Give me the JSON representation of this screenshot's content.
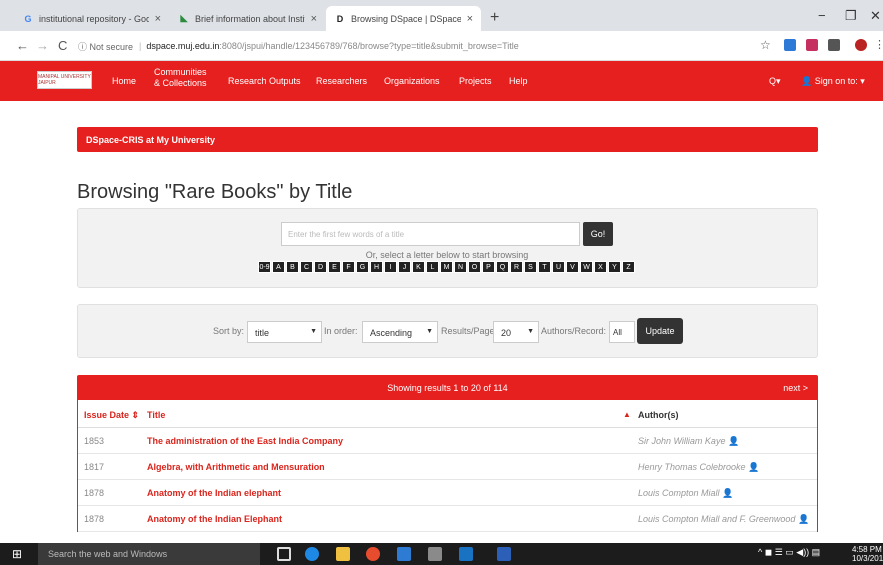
{
  "browser": {
    "tabs": [
      {
        "label": "institutional repository - Google",
        "icon": "G"
      },
      {
        "label": "Brief information about Instituti",
        "icon": "◣"
      },
      {
        "label": "Browsing DSpace | DSpace-CRIS",
        "icon": "D"
      }
    ],
    "new_tab": "+",
    "min": "−",
    "restore": "❐",
    "close": "✕",
    "back": "←",
    "forward": "→",
    "reload": "C",
    "not_secure": "ⓘ Not secure",
    "url_host": "dspace.muj.edu.in",
    "url_path": ":8080/jspui/handle/123456789/768/browse?type=title&submit_browse=Title",
    "star": "☆"
  },
  "nav": {
    "logo_text": "MANIPAL UNIVERSITY JAIPUR",
    "home": "Home",
    "communities_line1": "Communities",
    "communities_line2": "& Collections",
    "research_outputs": "Research Outputs",
    "researchers": "Researchers",
    "organizations": "Organizations",
    "projects": "Projects",
    "help": "Help",
    "search": "Q▾",
    "sign_on": "👤 Sign on to: ▾"
  },
  "notice": "DSpace-CRIS at My University",
  "page_title": "Browsing \"Rare Books\" by Title",
  "browse": {
    "placeholder": "Enter the first few words of a title",
    "go": "Go!",
    "hint": "Or, select a letter below to start browsing",
    "letters": [
      "0-9",
      "A",
      "B",
      "C",
      "D",
      "E",
      "F",
      "G",
      "H",
      "I",
      "J",
      "K",
      "L",
      "M",
      "N",
      "O",
      "P",
      "Q",
      "R",
      "S",
      "T",
      "U",
      "V",
      "W",
      "X",
      "Y",
      "Z"
    ]
  },
  "sort": {
    "sort_by_label": "Sort by:",
    "sort_by_value": "title",
    "order_label": "In order:",
    "order_value": "Ascending",
    "results_label": "Results/Page",
    "results_value": "20",
    "authors_label": "Authors/Record:",
    "authors_value": "All",
    "update": "Update"
  },
  "results": {
    "count_text": "Showing results 1 to 20 of 114",
    "next": "next >",
    "col_date": "Issue Date ⇕",
    "col_title": "Title",
    "col_authors": "Author(s)",
    "rows": [
      {
        "date": "1853",
        "title": "The administration of the East India Company",
        "authors": "Sir John William Kaye"
      },
      {
        "date": "1817",
        "title": "Algebra, with Arithmetic and Mensuration",
        "authors": "Henry Thomas Colebrooke"
      },
      {
        "date": "1878",
        "title": "Anatomy of the Indian elephant",
        "authors": "Louis Compton Miall"
      },
      {
        "date": "1878",
        "title": "Anatomy of the Indian Elephant",
        "authors": "Louis Compton Miall and F. Greenwood"
      }
    ]
  },
  "taskbar": {
    "start": "⊞",
    "search_placeholder": "Search the web and Windows",
    "time": "4:58 PM",
    "date": "10/3/201"
  },
  "colors": {
    "accent": "#e5201f"
  }
}
